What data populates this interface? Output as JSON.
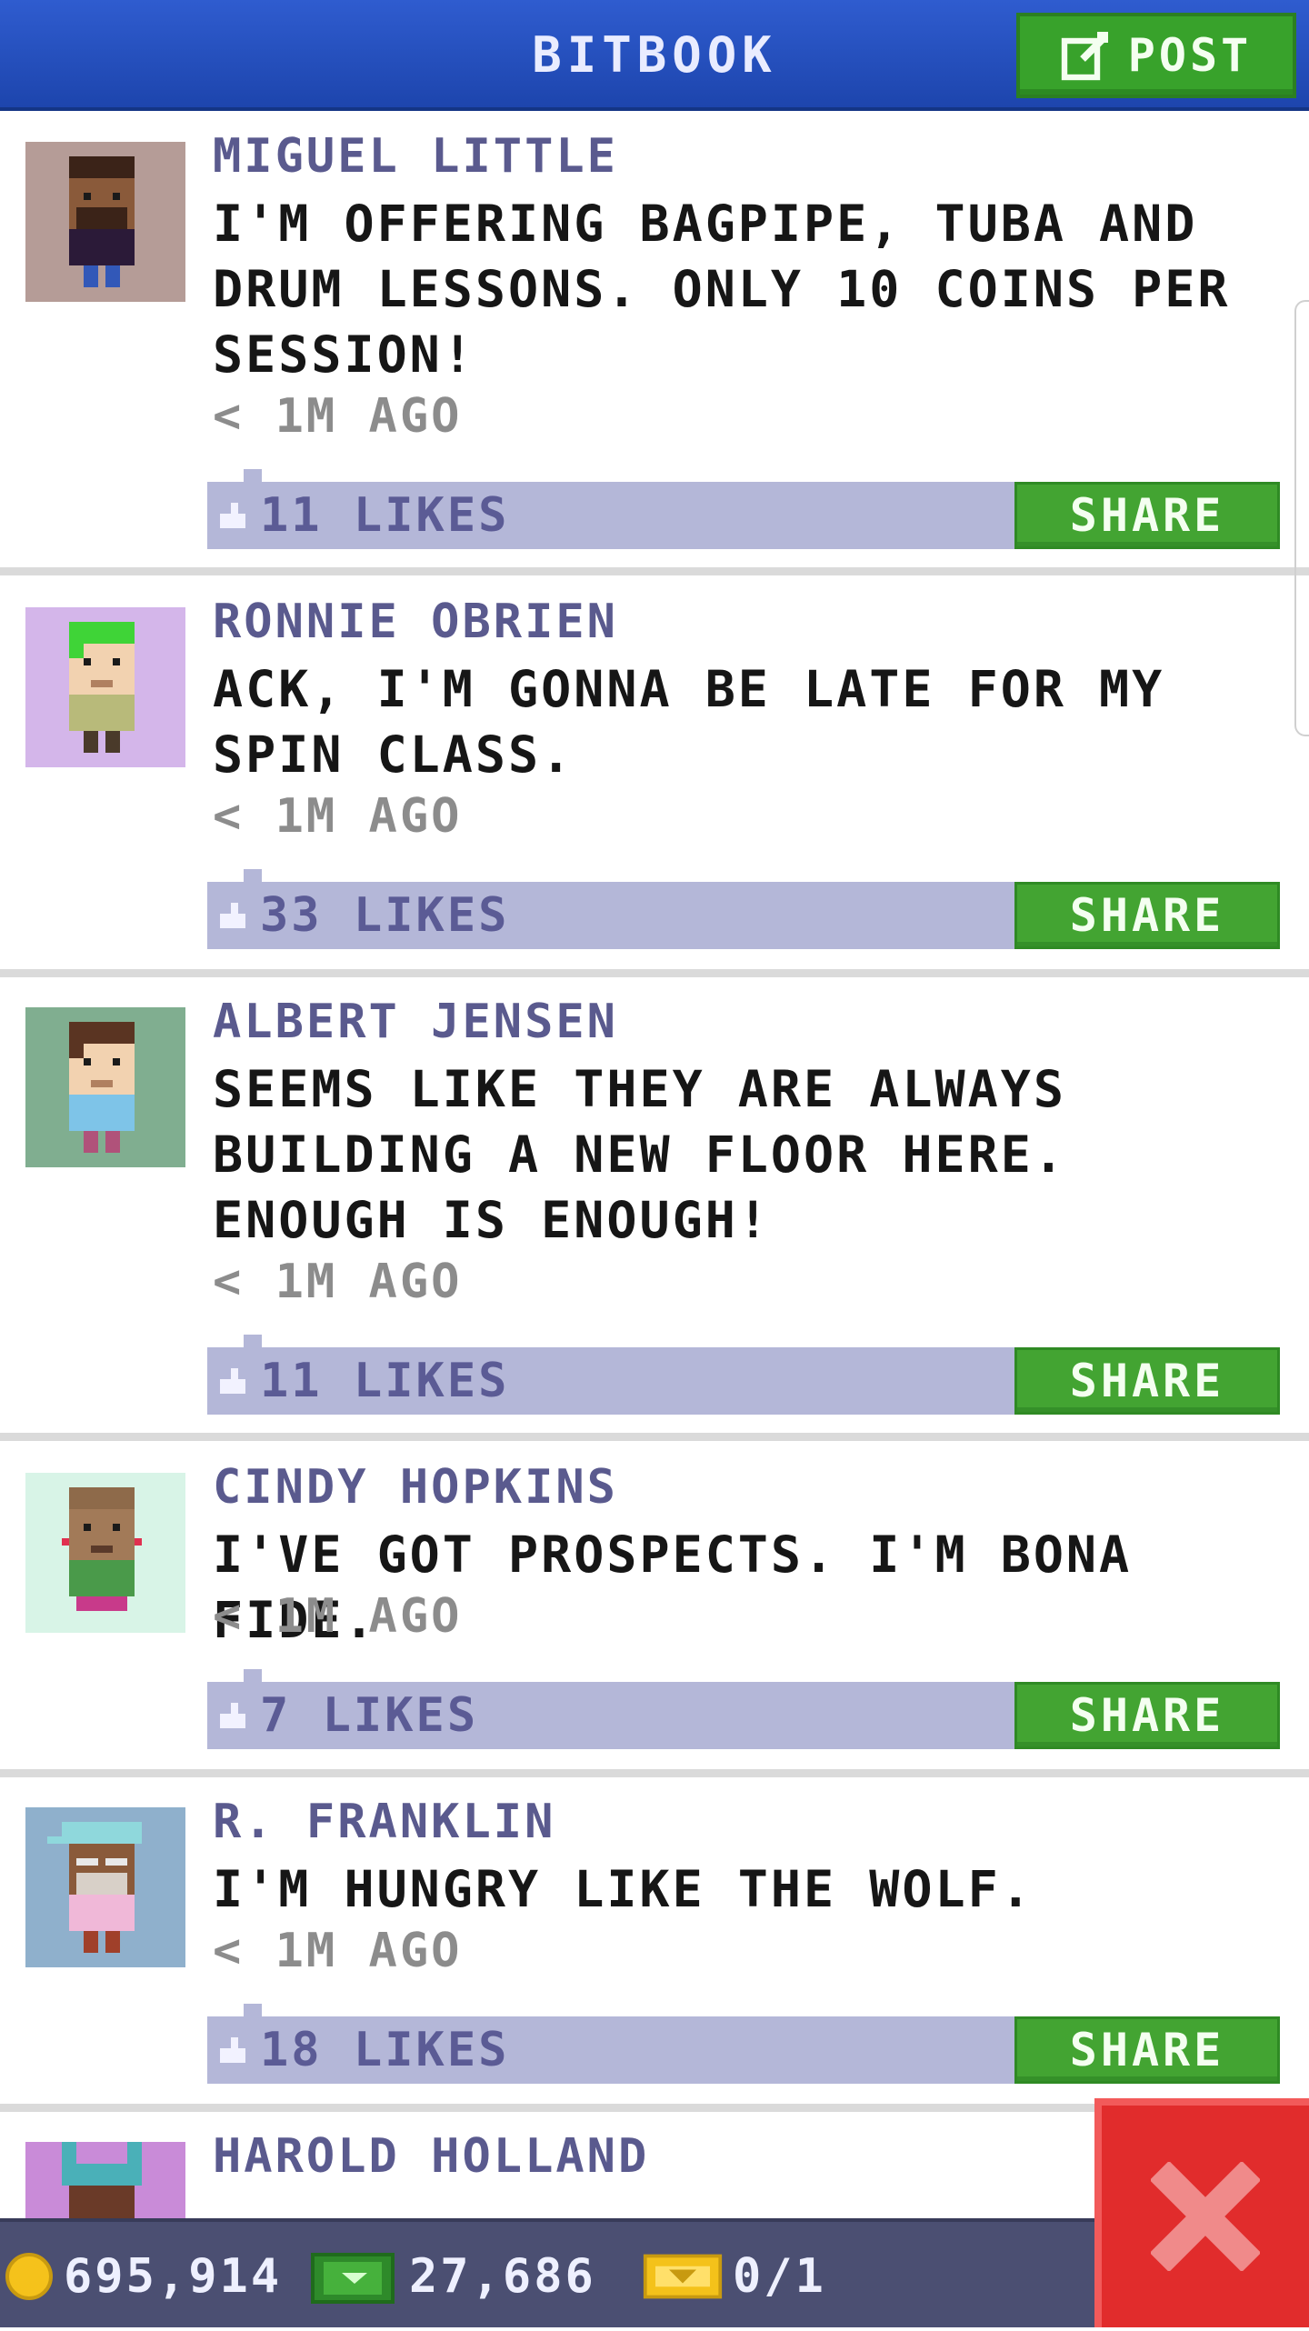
{
  "header": {
    "title": "BITBOOK",
    "post_label": "POST",
    "post_icon": "compose-icon"
  },
  "colors": {
    "header_blue": "#2a55c4",
    "post_green": "#38a22b",
    "like_bar": "#b4b7d8",
    "author_purple": "#5a5a8e",
    "close_red": "#e12c2c",
    "status_bar": "#4b4f72"
  },
  "posts": [
    {
      "author": "MIGUEL LITTLE",
      "text": "I'M OFFERING BAGPIPE, TUBA AND DRUM LESSONS. ONLY 10 COINS PER SESSION!",
      "time": "< 1M AGO",
      "likes": "11 LIKES",
      "share_label": "SHARE",
      "avatar_bg": "#b59c97"
    },
    {
      "author": "RONNIE OBRIEN",
      "text": "ACK, I'M GONNA BE LATE FOR MY SPIN CLASS.",
      "time": "< 1M AGO",
      "likes": "33 LIKES",
      "share_label": "SHARE",
      "avatar_bg": "#d4b6ea"
    },
    {
      "author": "ALBERT JENSEN",
      "text": "SEEMS LIKE THEY ARE ALWAYS BUILDING A NEW FLOOR HERE. ENOUGH IS ENOUGH!",
      "time": "< 1M AGO",
      "likes": "11 LIKES",
      "share_label": "SHARE",
      "avatar_bg": "#80ae90"
    },
    {
      "author": "CINDY HOPKINS",
      "text": "I'VE GOT PROSPECTS. I'M BONA FIDE.",
      "time": "< 1M AGO",
      "likes": "7 LIKES",
      "share_label": "SHARE",
      "avatar_bg": "#d8f4e7"
    },
    {
      "author": "R. FRANKLIN",
      "text": "I'M HUNGRY LIKE THE WOLF.",
      "time": "< 1M AGO",
      "likes": "18 LIKES",
      "share_label": "SHARE",
      "avatar_bg": "#8fb0cc"
    },
    {
      "author": "HAROLD HOLLAND",
      "avatar_bg": "#c98bd8"
    }
  ],
  "status_bar": {
    "coins": "695,914",
    "bux": "27,686",
    "tickets": "0/1",
    "coin_icon": "coin-icon",
    "bux_icon": "bux-icon",
    "ticket_icon": "golden-ticket-icon"
  }
}
